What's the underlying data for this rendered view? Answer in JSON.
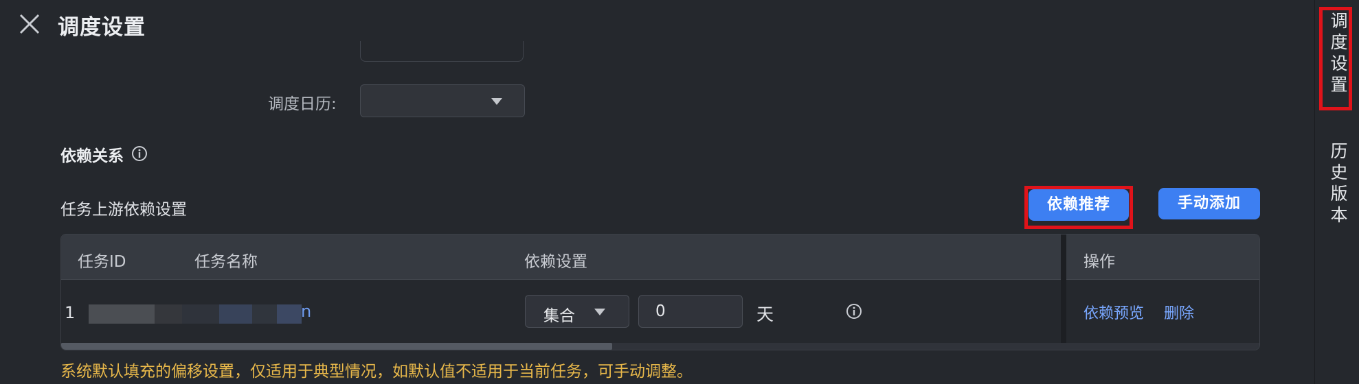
{
  "header": {
    "title": "调度设置"
  },
  "schedule": {
    "calendar_label": "调度日历:",
    "calendar_value": ""
  },
  "dependency": {
    "section_title": "依赖关系",
    "upstream_title": "任务上游依赖设置",
    "recommend_button": "依赖推荐",
    "manual_add_button": "手动添加",
    "table": {
      "columns": [
        "任务ID",
        "任务名称",
        "依赖设置",
        "操作"
      ],
      "rows": [
        {
          "task_id": "1",
          "task_name_visible_tail": "n",
          "dep_mode": "集合",
          "offset_value": "0",
          "offset_unit": "天",
          "actions": [
            "依赖预览",
            "删除"
          ]
        }
      ]
    },
    "scroll_fraction_visible": 0.46,
    "warning": "系统默认填充的偏移设置，仅适用于典型情况，如默认值不适用于当前任务，可手动调整。"
  },
  "side_tabs": [
    "调度设置",
    "历史版本"
  ],
  "colors": {
    "background": "#25282d",
    "primary_button": "#3d7ff2",
    "link": "#79a7ff",
    "warning": "#e8b84a",
    "highlight_box": "#e0131a"
  },
  "icons": [
    "close-icon",
    "info-icon",
    "chevron-down-icon"
  ]
}
